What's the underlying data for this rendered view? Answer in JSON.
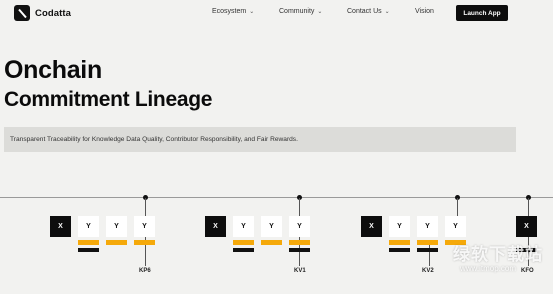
{
  "nav": {
    "brand": "Codatta",
    "items": [
      {
        "label": "Ecosystem",
        "dropdown": true
      },
      {
        "label": "Community",
        "dropdown": true
      },
      {
        "label": "Contact Us",
        "dropdown": true
      },
      {
        "label": "Vision",
        "dropdown": false
      }
    ],
    "cta": "Launch App"
  },
  "hero": {
    "title_line1": "Onchain",
    "title_line2": "Commitment Lineage",
    "subtitle": "Transparent Traceability for Knowledge Data Quality, Contributor Responsibility, and Fair Rewards."
  },
  "timeline": {
    "groups": [
      {
        "blocks": [
          "X",
          "Y",
          "Y",
          "Y"
        ],
        "label": "KP6"
      },
      {
        "blocks": [
          "X",
          "Y",
          "Y",
          "Y"
        ],
        "label": "KV1"
      },
      {
        "blocks": [
          "X",
          "Y",
          "Y",
          "Y"
        ],
        "label": "KV2"
      },
      {
        "blocks": [
          "X"
        ],
        "label": "KFO"
      }
    ]
  },
  "watermark": {
    "line1": "绿软下载站",
    "line2": "www.itmop.com"
  },
  "colors": {
    "background": "#f2f2f0",
    "accent": "#f5a90a",
    "dark": "#0d0d0d",
    "subtitle_bg": "#dcdcd9"
  }
}
